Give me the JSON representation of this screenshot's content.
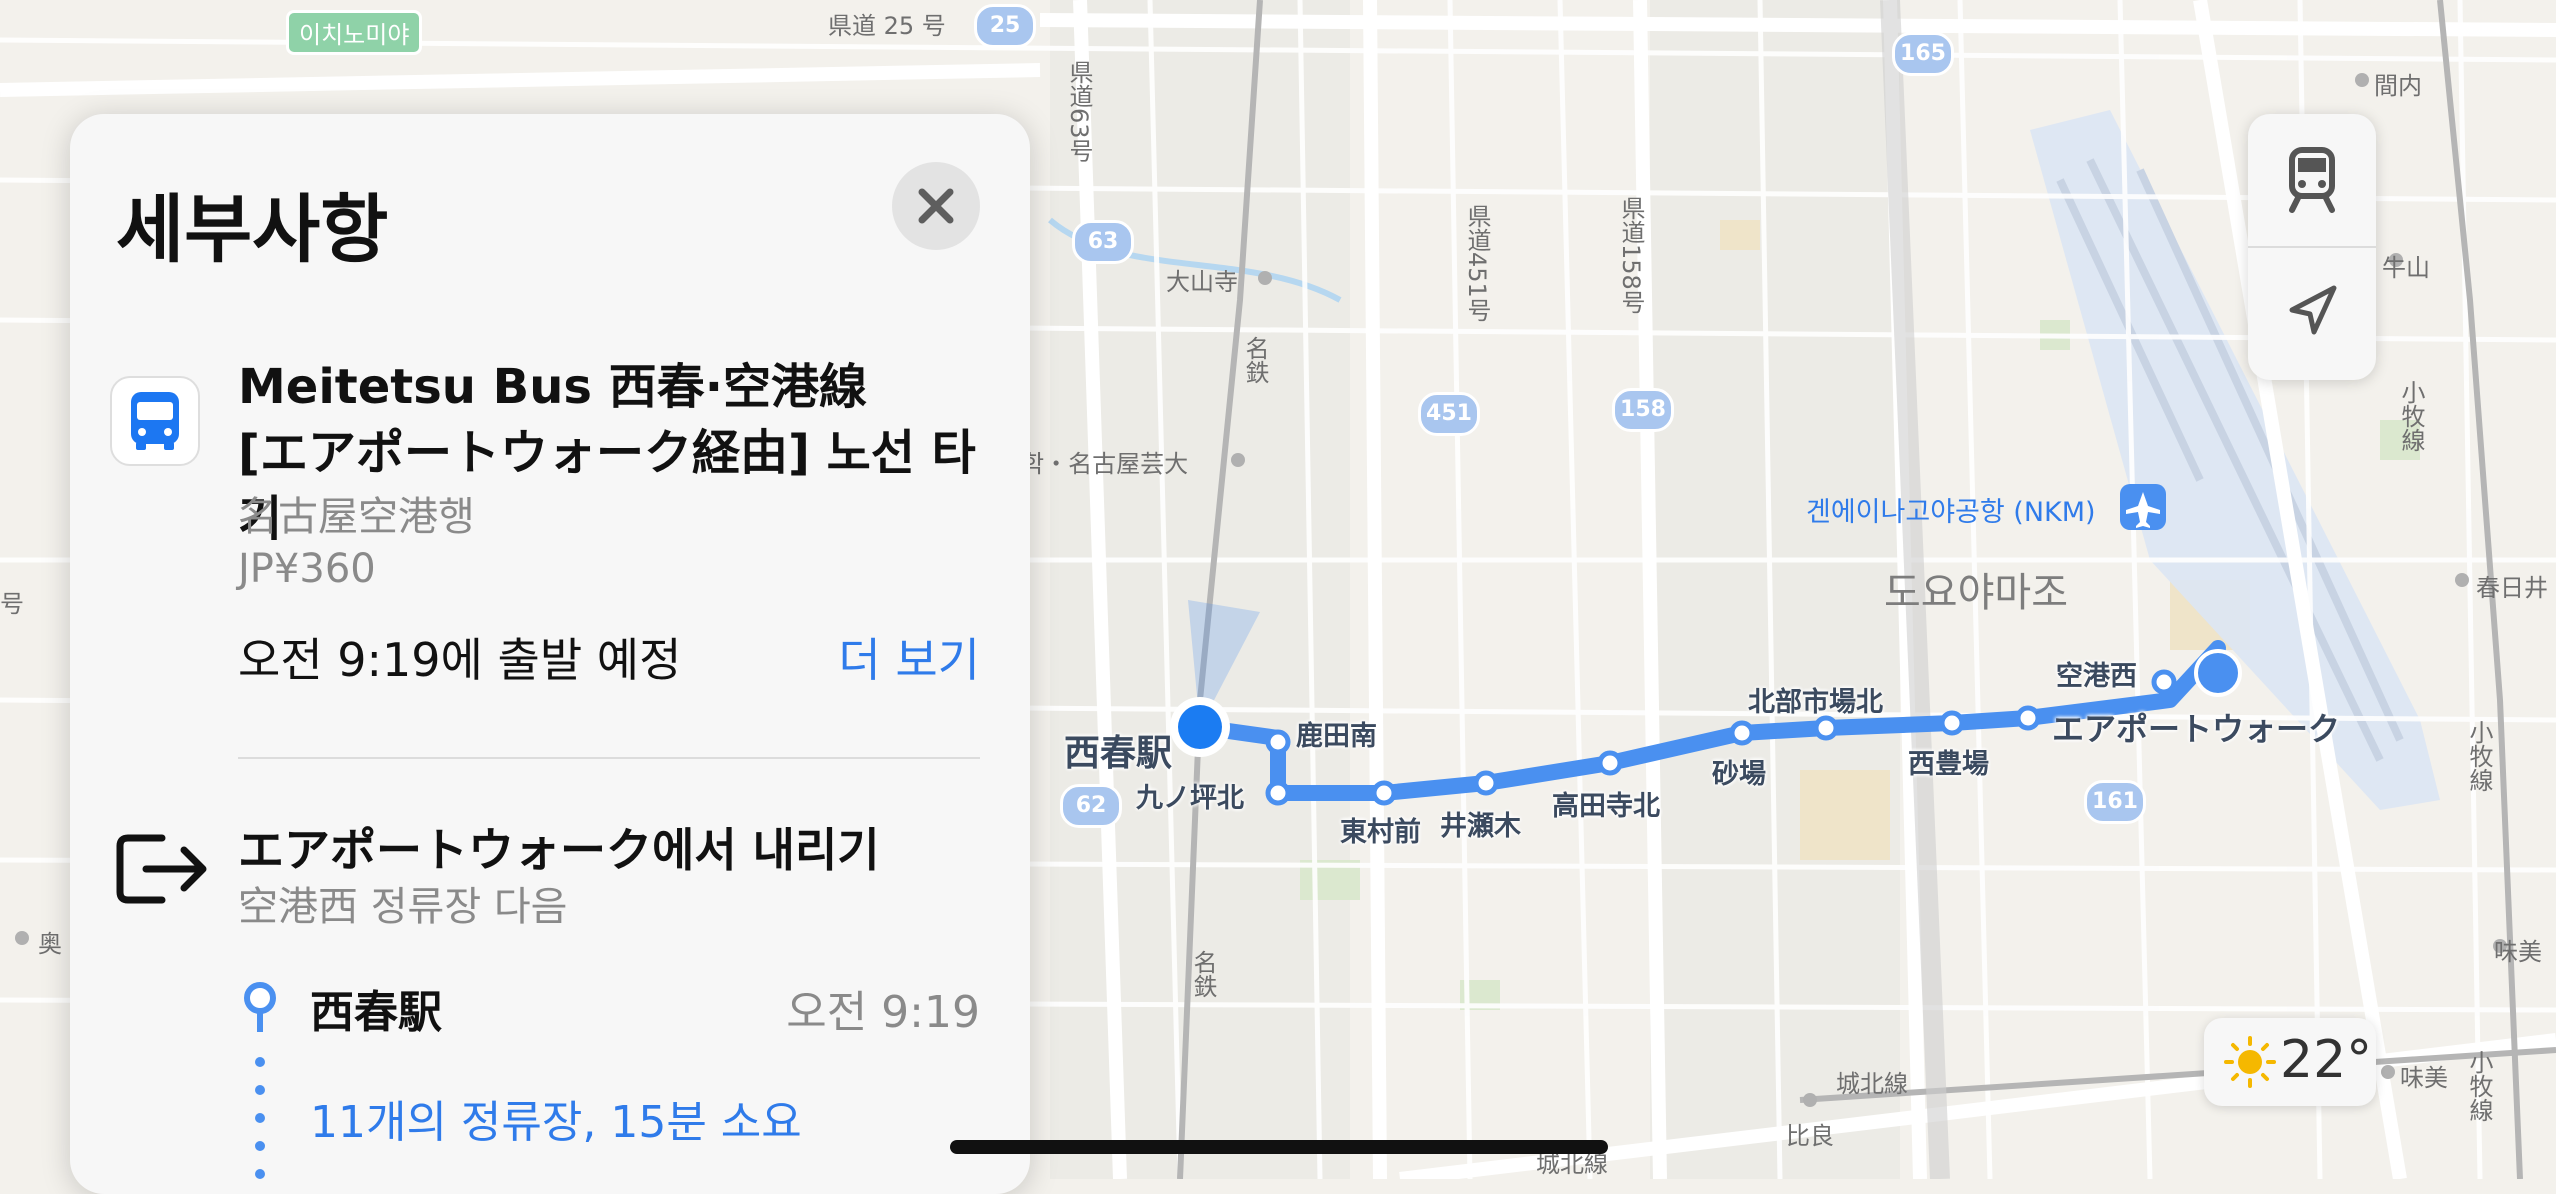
{
  "panel": {
    "title": "세부사항",
    "route_line1": "Meitetsu Bus 西春·空港線",
    "route_line2": "[エアポートウォーク経由] 노선 타기",
    "destination": "名古屋空港행",
    "fare": "JP¥360",
    "departure": "오전 9:19에 출발 예정",
    "more_label": "더 보기",
    "alight_title": "エアポートウォーク에서 내리기",
    "alight_sub": "空港西 정류장 다음",
    "boarding_stop": "西春駅",
    "boarding_time": "오전 9:19",
    "stops_summary": "11개의 정류장, 15분 소요"
  },
  "weather": {
    "temp": "22°",
    "icon": "sun-icon"
  },
  "controls": {
    "transit_icon": "train-icon",
    "location_icon": "location-arrow-icon"
  },
  "map": {
    "places": {
      "ichinomiya": "이치노미야",
      "prefroad25": "県道 25 号",
      "daisanji": "大山寺",
      "meigeidai": "학・名古屋芸大",
      "airport": "겐에이나고야공항 (NKM)",
      "toyoyama": "도요야마조",
      "mannai": "間内",
      "ushiyama": "牛山",
      "kasugai": "春日井",
      "aji": "味美",
      "aji2": "味美",
      "oku": "奥",
      "hira": "比良",
      "johoku": "城北線",
      "johoku2": "城北線",
      "meitetsu1": "名鉄",
      "meitetsu2": "名鉄",
      "pref63": "県道63号",
      "pref451": "県道451号",
      "pref158": "県道158号",
      "komaki1": "小牧線",
      "komaki2": "小牧線",
      "komaki3": "小牧線",
      "go": "号"
    },
    "shields": [
      "25",
      "63",
      "451",
      "158",
      "165",
      "62",
      "161"
    ],
    "stops": {
      "nishiharu": "西春駅",
      "kanodaminami": "鹿田南",
      "kunotsubokita": "九ノ坪北",
      "higashimuramae": "東村前",
      "isemoku": "井瀬木",
      "takadaterakita": "高田寺北",
      "sunaba": "砂場",
      "hokubushijokita": "北部市場北",
      "nishitoyoba": "西豊場",
      "airportwalk": "エアポートウォーク",
      "kukonishi": "空港西"
    }
  }
}
